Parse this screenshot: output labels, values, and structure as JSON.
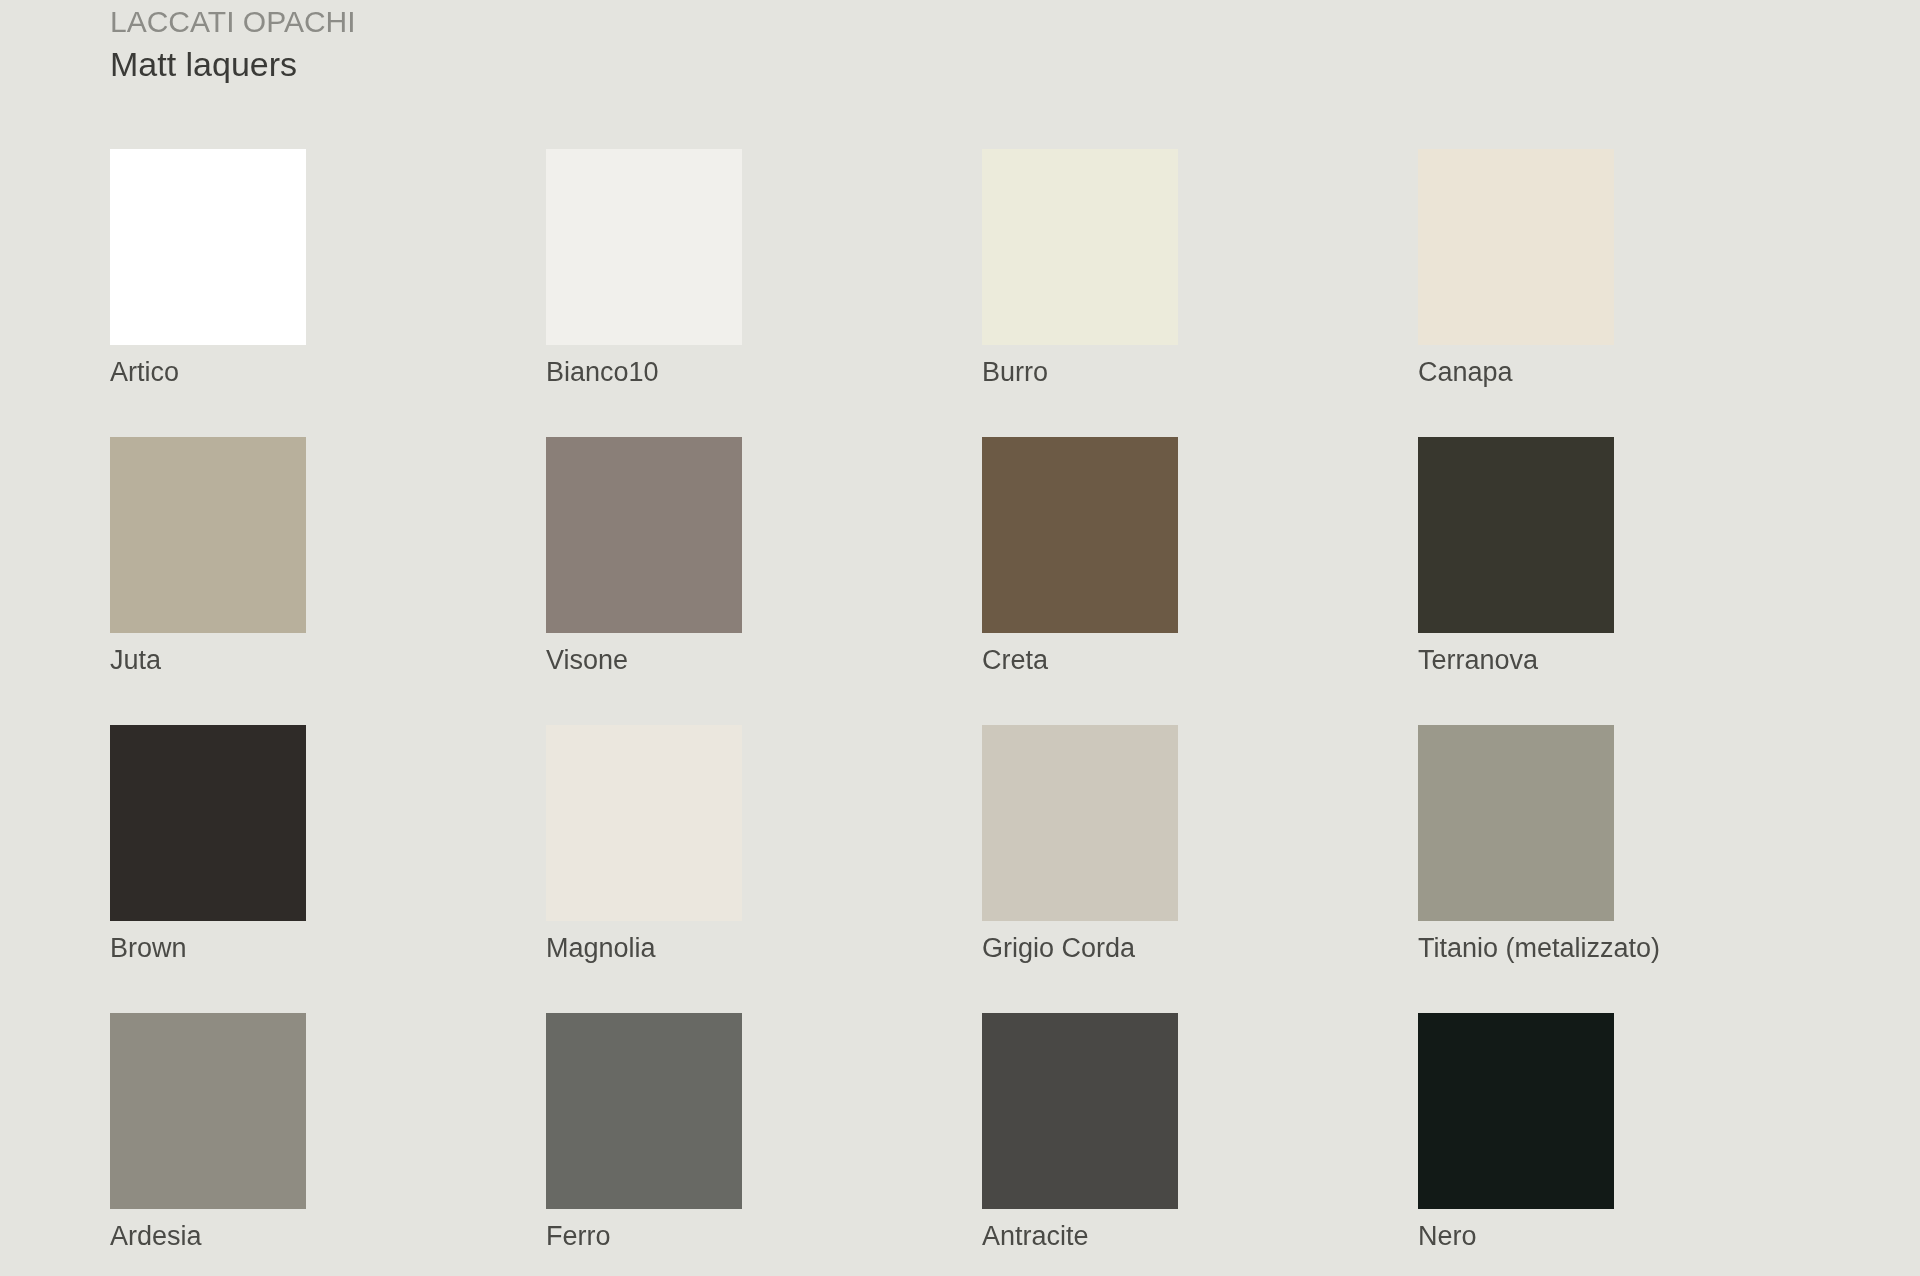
{
  "header": {
    "title": "LACCATI OPACHI",
    "subtitle": "Matt laquers"
  },
  "swatches": [
    {
      "name": "Artico",
      "color": "#ffffff"
    },
    {
      "name": "Bianco10",
      "color": "#f1f0ec"
    },
    {
      "name": "Burro",
      "color": "#ecebdb"
    },
    {
      "name": "Canapa",
      "color": "#ebe4d6"
    },
    {
      "name": "Juta",
      "color": "#b8b09c"
    },
    {
      "name": "Visone",
      "color": "#8a7f78"
    },
    {
      "name": "Creta",
      "color": "#6c5a45"
    },
    {
      "name": "Terranova",
      "color": "#38372e"
    },
    {
      "name": "Brown",
      "color": "#2f2b28"
    },
    {
      "name": "Magnolia",
      "color": "#ebe7de"
    },
    {
      "name": "Grigio Corda",
      "color": "#cdc8bc"
    },
    {
      "name": "Titanio (metalizzato)",
      "color": "#9b998b"
    },
    {
      "name": "Ardesia",
      "color": "#8f8c82"
    },
    {
      "name": "Ferro",
      "color": "#686964"
    },
    {
      "name": "Antracite",
      "color": "#494845"
    },
    {
      "name": "Nero",
      "color": "#121a17"
    }
  ]
}
